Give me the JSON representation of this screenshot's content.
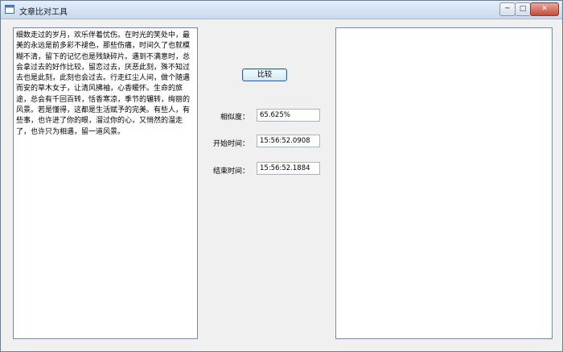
{
  "window": {
    "title": "文章比对工具",
    "controls": {
      "minimize": "─",
      "maximize": "□",
      "close": "✕"
    }
  },
  "left_text": "细数走过的岁月，欢乐伴着忧伤。在时光的笑处中，最美的永远是前多彩不褪色，那些伤痛，时间久了也就模糊不清，留下的记忆也是残缺碎片。遇到不满意时，总会拿过去的好作比较，留恋过去，厌恶此刻，殊不知过去也是此刻，此刻也会过去。行走红尘人间，做个随遇而安的草木女子，让清风拂袖，心香暖怀。生命的旅途，总会有千回百转，恬香寒凉，季节的辗转，绚丽的风景。若是懂得，这都是生活赋予的完美。有些人，有些事，也许进了你的眼，溜过你的心，又悄然的溜走了，也许只为相遇，留一道风景。",
  "right_text": "",
  "compare_button": "比较",
  "similarity": {
    "label": "相似度：",
    "value": "65.625%"
  },
  "start_time": {
    "label": "开始时间：",
    "value": "15:56:52.0908"
  },
  "end_time": {
    "label": "结束时间：",
    "value": "15:56:52.1884"
  }
}
